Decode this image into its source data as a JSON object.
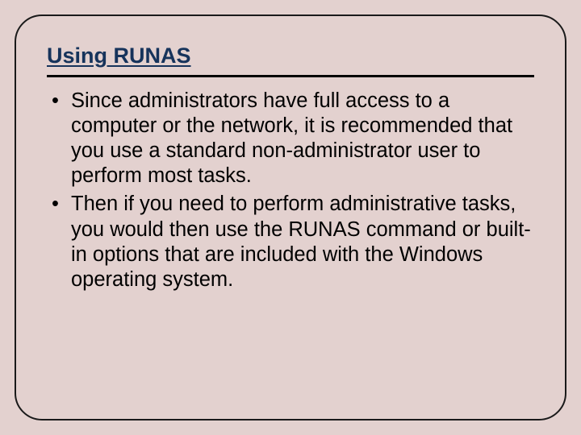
{
  "slide": {
    "title": "Using RUNAS",
    "bullets": [
      "Since administrators have full access to a computer or the network, it is recommended that you use a standard non-administrator user to perform most tasks.",
      "Then if you need to perform administrative tasks, you would then use the RUNAS command or built-in options that are included with the Windows operating system."
    ]
  }
}
